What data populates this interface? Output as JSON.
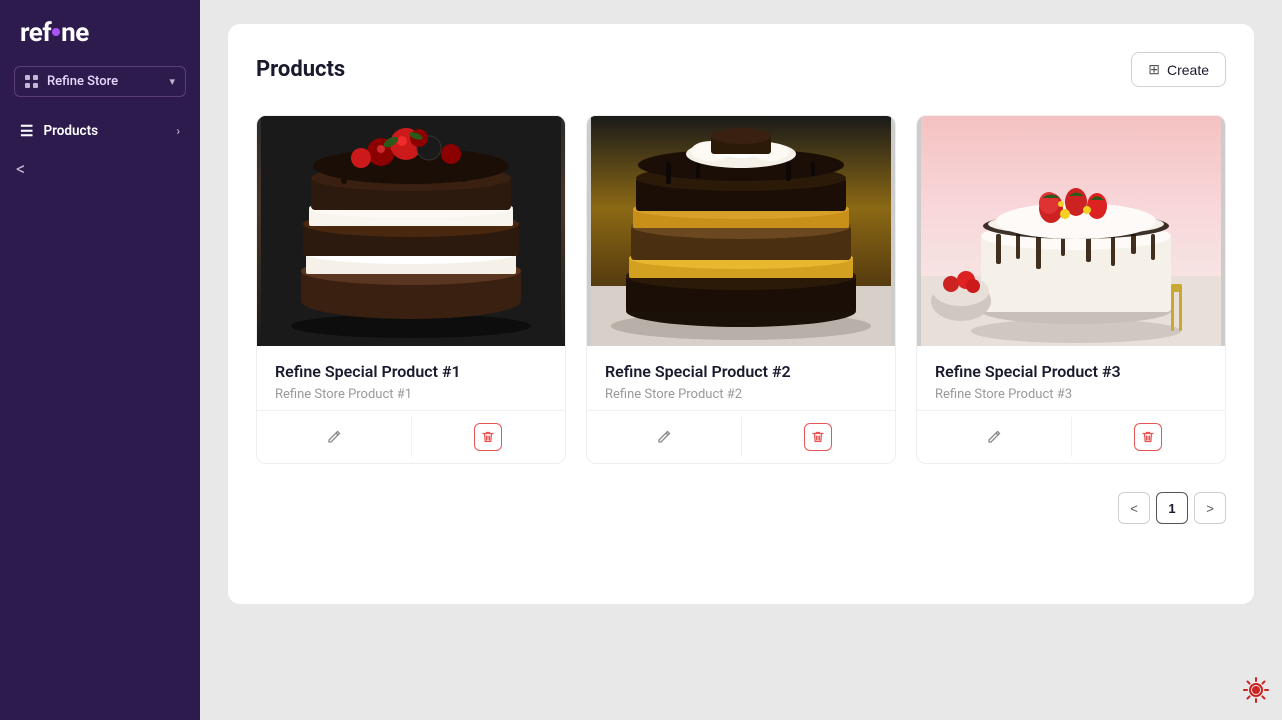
{
  "sidebar": {
    "logo": "refine",
    "store_selector": {
      "label": "Refine Store",
      "icon": "grid-icon"
    },
    "nav_items": [
      {
        "id": "products",
        "label": "Products",
        "icon": "list-icon",
        "active": true
      }
    ],
    "back_label": "<"
  },
  "header": {
    "title": "Products",
    "create_button": "Create",
    "create_icon": "plus-square-icon"
  },
  "products": [
    {
      "id": 1,
      "name": "Refine Special Product #1",
      "subtitle": "Refine Store Product #1",
      "image_theme": "dark-berry",
      "edit_label": "✏",
      "delete_label": "🗑"
    },
    {
      "id": 2,
      "name": "Refine Special Product #2",
      "subtitle": "Refine Store Product #2",
      "image_theme": "caramel",
      "edit_label": "✏",
      "delete_label": "🗑"
    },
    {
      "id": 3,
      "name": "Refine Special Product #3",
      "subtitle": "Refine Store Product #3",
      "image_theme": "pink-strawberry",
      "edit_label": "✏",
      "delete_label": "🗑"
    }
  ],
  "pagination": {
    "current_page": 1,
    "prev_icon": "<",
    "next_icon": ">"
  },
  "settings_icon": "⚙"
}
